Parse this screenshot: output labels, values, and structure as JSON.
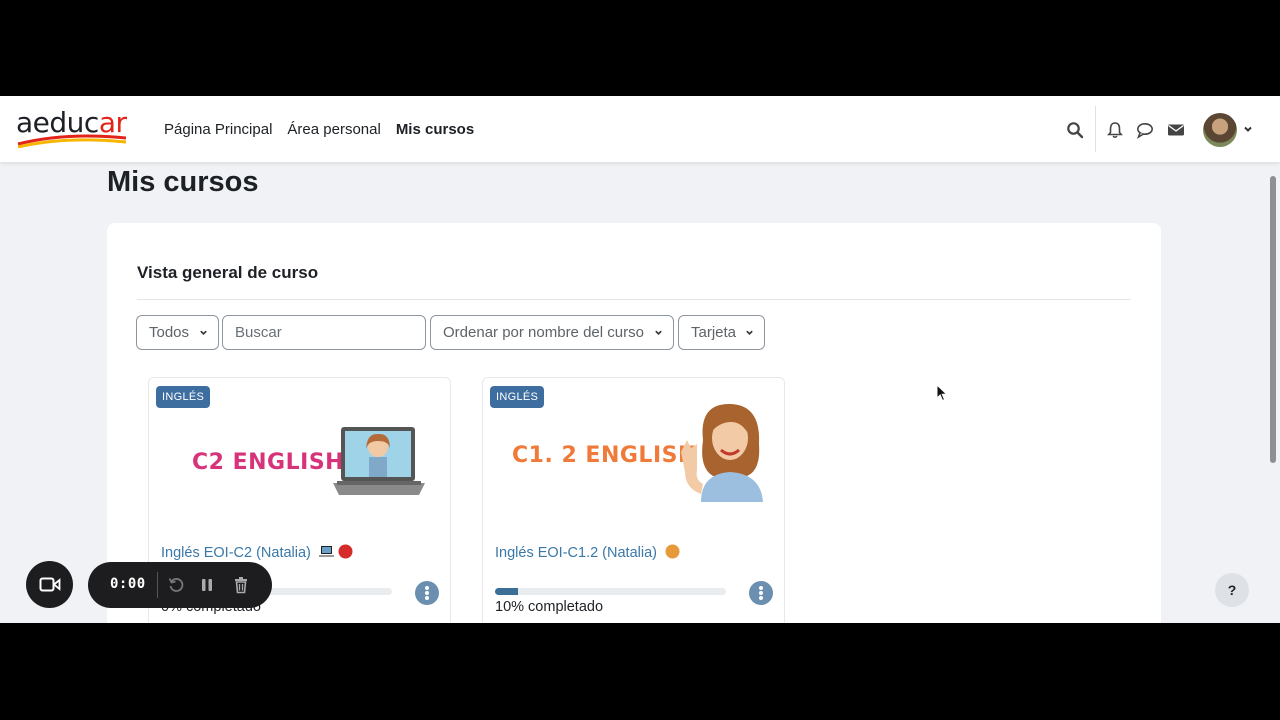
{
  "brand": {
    "logo_text_main": "aeduc",
    "logo_text_accent": "ar"
  },
  "nav": {
    "links": [
      {
        "label": "Página Principal",
        "active": false
      },
      {
        "label": "Área personal",
        "active": false
      },
      {
        "label": "Mis cursos",
        "active": true
      }
    ],
    "icons": [
      "search-icon",
      "bell-icon",
      "chat-icon",
      "mail-icon"
    ]
  },
  "page": {
    "title": "Mis cursos"
  },
  "overview": {
    "title": "Vista general de curso",
    "filter_label": "Todos",
    "search_placeholder": "Buscar",
    "sort_label": "Ordenar por nombre del curso",
    "view_label": "Tarjeta"
  },
  "courses": [
    {
      "category": "INGLÉS",
      "image_title": "C2 ENGLISH",
      "image_title_color": "#d6337a",
      "name": "Inglés EOI-C2 (Natalia)",
      "emojis": [
        "laptop-emoji",
        "red-circle-emoji"
      ],
      "progress_pct": 0,
      "progress_label": "0% completado"
    },
    {
      "category": "INGLÉS",
      "image_title": "C1. 2 ENGLISH",
      "image_title_color": "#ef7a3a",
      "name": "Inglés EOI-C1.2 (Natalia)",
      "emojis": [
        "orange-circle-emoji"
      ],
      "progress_pct": 10,
      "progress_label": "10% completado"
    }
  ],
  "recorder": {
    "time": "0:00"
  },
  "help": {
    "label": "?"
  },
  "colors": {
    "accent": "#3b6f95",
    "link": "#3a78a8",
    "badge": "#3e6ea0",
    "background": "#f0f2f5"
  }
}
